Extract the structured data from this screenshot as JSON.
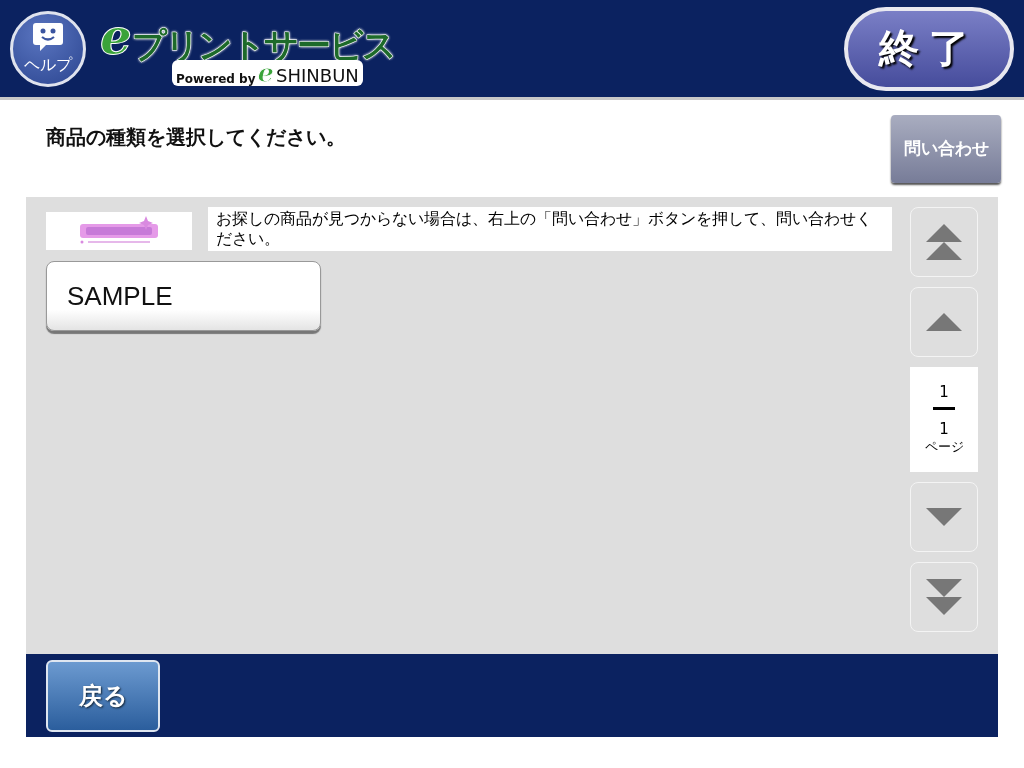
{
  "header": {
    "help_button": {
      "label": "ヘルプ"
    },
    "logo": {
      "e_mark": "e",
      "title": "プリントサービス",
      "powered_by": "Powered by",
      "sub_e_mark": "e",
      "sub_brand": "SHINBUN"
    },
    "exit_button": {
      "label": "終了"
    }
  },
  "instruction": "商品の種類を選択してください。",
  "inquiry_button": {
    "label": "問い合わせ"
  },
  "notice": {
    "text": "お探しの商品が見つからない場合は、右上の「問い合わせ」ボタンを押して、問い合わせください。"
  },
  "products": [
    {
      "label": "SAMPLE"
    }
  ],
  "pager": {
    "first": {
      "kind": "first",
      "disabled": true
    },
    "prev": {
      "kind": "prev",
      "disabled": true
    },
    "current": "1",
    "total": "1",
    "unit": "ページ",
    "next": {
      "kind": "next",
      "disabled": true
    },
    "last": {
      "kind": "last",
      "disabled": true
    }
  },
  "footer": {
    "back_button": {
      "label": "戻る"
    }
  }
}
